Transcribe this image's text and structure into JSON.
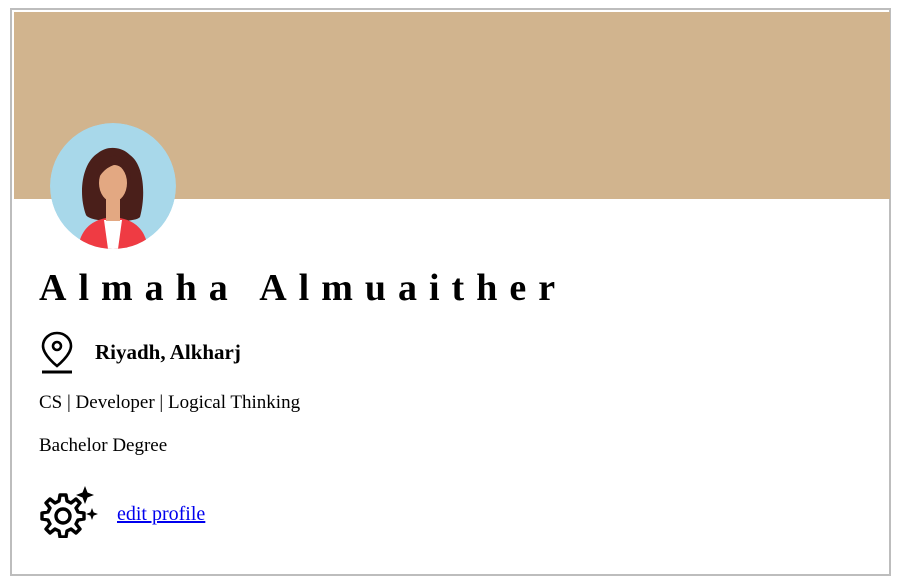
{
  "colors": {
    "banner": "#d1b48e",
    "avatar_bg": "#a8d8ea",
    "hair": "#4a1f1a",
    "skin": "#e3a882",
    "jacket": "#ef3b43",
    "link": "#0000ee"
  },
  "profile": {
    "name": "Almaha Almuaither",
    "location": "Riyadh, Alkharj",
    "headline": "CS | Developer | Logical Thinking",
    "degree": "Bachelor Degree",
    "edit_link": "edit profile"
  },
  "icons": {
    "avatar": "female-avatar-illustration",
    "location": "location-pin-icon",
    "settings": "gear-sparkle-icon"
  }
}
